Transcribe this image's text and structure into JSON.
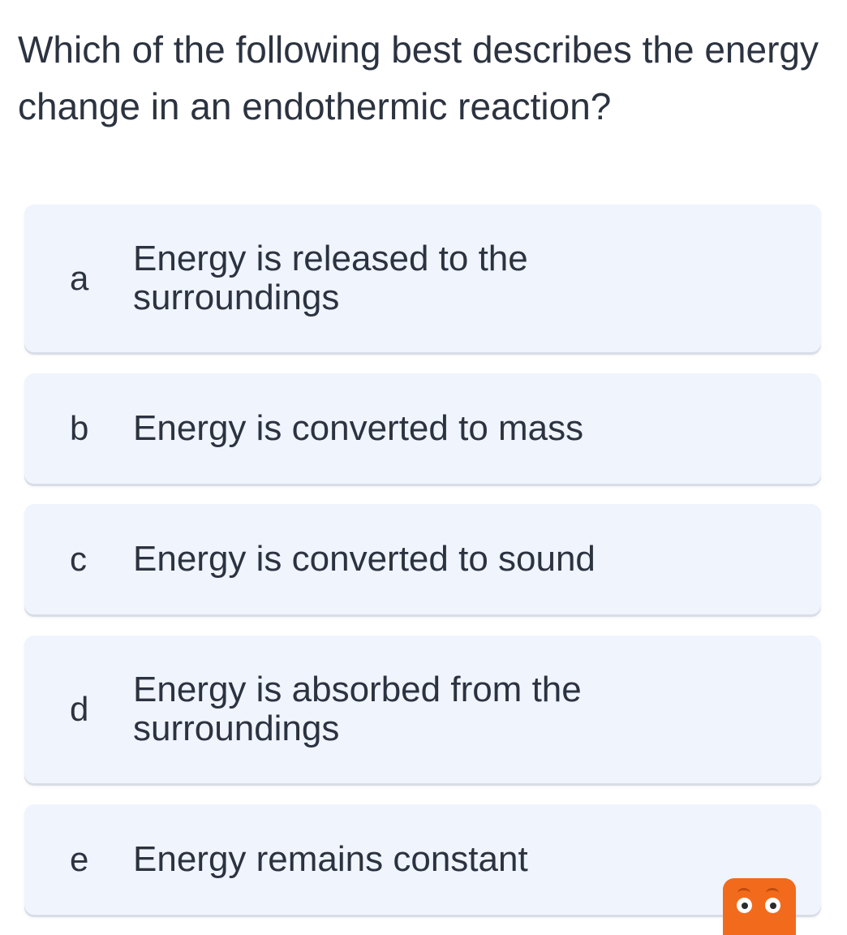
{
  "question": {
    "text": "Which of the following best describes the energy change in an endothermic reaction?"
  },
  "options": [
    {
      "letter": "a",
      "text": "Energy is released to the surroundings"
    },
    {
      "letter": "b",
      "text": "Energy is converted to mass"
    },
    {
      "letter": "c",
      "text": "Energy is converted to sound"
    },
    {
      "letter": "d",
      "text": "Energy is absorbed from the surroundings"
    },
    {
      "letter": "e",
      "text": "Energy remains constant"
    }
  ],
  "mascot": {
    "icon": "orange-monster-mascot-icon",
    "color": "#f26b1d"
  },
  "colors": {
    "option_background": "#f0f4fd",
    "text": "#2c3340"
  }
}
